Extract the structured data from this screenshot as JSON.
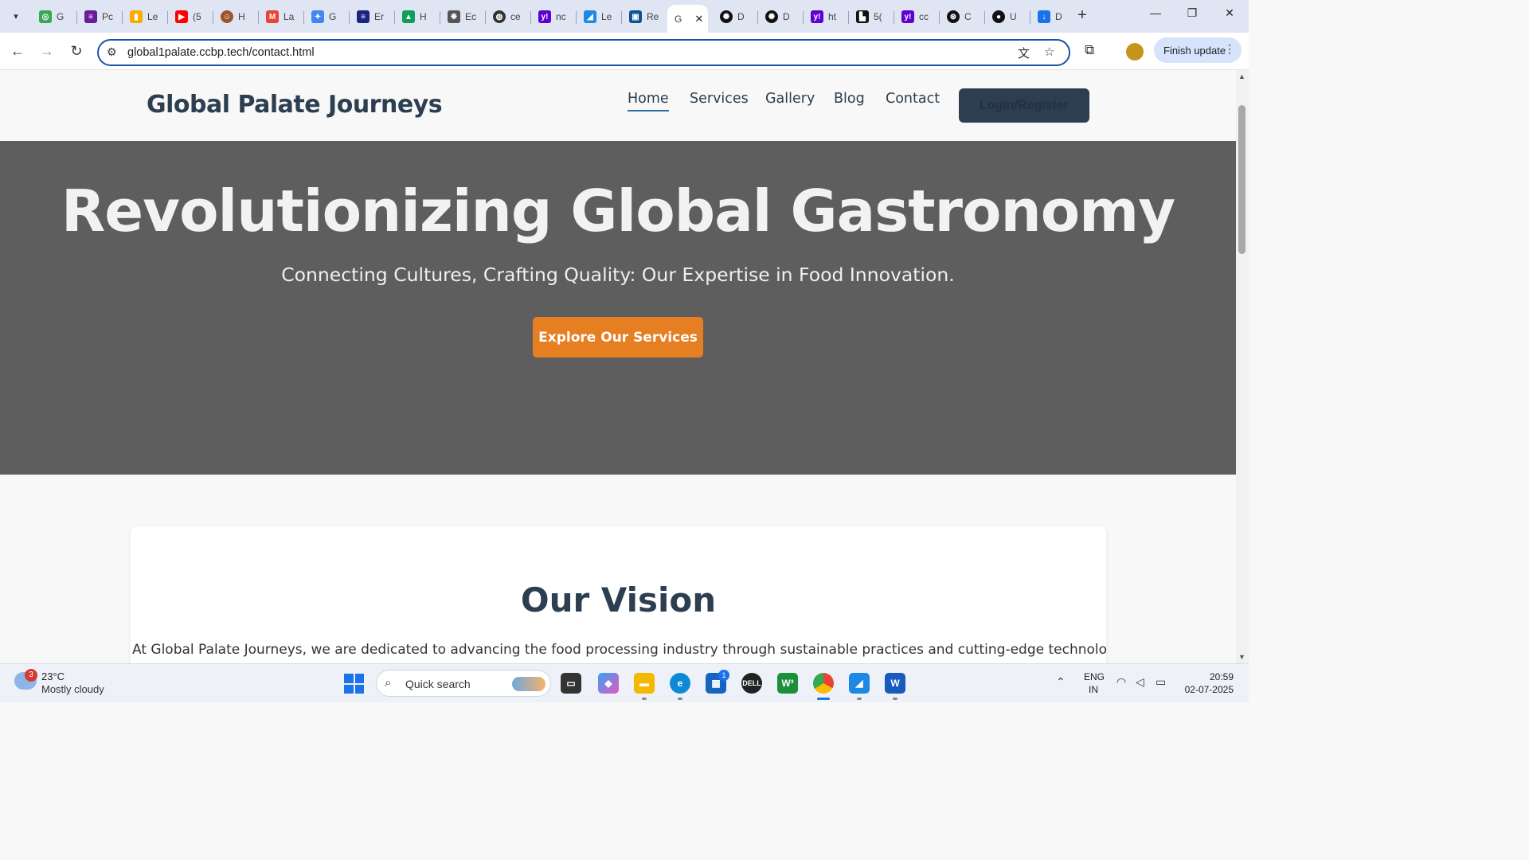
{
  "browser": {
    "tabs": [
      {
        "icon": "search-tabs-icon"
      },
      {
        "title": "G",
        "icon": "google-lens-icon",
        "color": "#34a853"
      },
      {
        "title": "Pc",
        "icon": "notes-icon",
        "color": "#6a1b9a"
      },
      {
        "title": "Le",
        "icon": "chart-icon",
        "color": "#f9ab00"
      },
      {
        "title": "(5",
        "icon": "youtube-icon",
        "color": "#ff0000"
      },
      {
        "title": "H",
        "icon": "avatar-icon",
        "color": "#a0522d"
      },
      {
        "title": "La",
        "icon": "gmail-icon",
        "color": "#ea4335"
      },
      {
        "title": "G",
        "icon": "gemini-icon",
        "color": "#4285f4"
      },
      {
        "title": "Er",
        "icon": "iit-icon",
        "color": "#1a237e"
      },
      {
        "title": "H",
        "icon": "drive-icon",
        "color": "#0f9d58"
      },
      {
        "title": "Ec",
        "icon": "brain-icon",
        "color": "#555555"
      },
      {
        "title": "ce",
        "icon": "globe-icon",
        "color": "#333333"
      },
      {
        "title": "nc",
        "icon": "yahoo-icon",
        "color": "#6001d2"
      },
      {
        "title": "Le",
        "icon": "graph-icon",
        "color": "#1e88e5"
      },
      {
        "title": "Re",
        "icon": "site-icon",
        "color": "#0b5394"
      },
      {
        "title": "G",
        "icon": "page-icon",
        "active": true
      },
      {
        "title": "D",
        "icon": "openai-icon",
        "color": "#111111"
      },
      {
        "title": "D",
        "icon": "openai-icon",
        "color": "#111111"
      },
      {
        "title": "ht",
        "icon": "yahoo-icon",
        "color": "#6001d2"
      },
      {
        "title": "5(",
        "icon": "briefcase-icon",
        "color": "#111111"
      },
      {
        "title": "cc",
        "icon": "yahoo-icon",
        "color": "#6001d2"
      },
      {
        "title": "C",
        "icon": "aperture-icon",
        "color": "#111111"
      },
      {
        "title": "U",
        "icon": "github-icon",
        "color": "#111111"
      },
      {
        "title": "D",
        "icon": "download-icon",
        "color": "#1a73e8"
      }
    ],
    "active_tab_close": "✕",
    "new_tab": "+",
    "window_controls": {
      "minimize": "—",
      "restore": "❐",
      "close": "✕"
    },
    "url": "global1palate.ccbp.tech/contact.html",
    "finish_update": "Finish update"
  },
  "site": {
    "logo": "Global Palate Journeys",
    "nav": [
      {
        "label": "Home",
        "active": true
      },
      {
        "label": "Services"
      },
      {
        "label": "Gallery"
      },
      {
        "label": "Blog"
      },
      {
        "label": "Contact"
      }
    ],
    "login": "Login/Register",
    "hero": {
      "title": "Revolutionizing Global Gastronomy",
      "subtitle": "Connecting Cultures, Crafting Quality: Our Expertise in Food Innovation.",
      "cta": "Explore Our Services"
    },
    "vision": {
      "title": "Our Vision",
      "text": "At Global Palate Journeys, we are dedicated to advancing the food processing industry through sustainable practices and cutting-edge technology. Our mission is"
    },
    "colors": {
      "primary": "#2c3e50",
      "accent": "#e67e22",
      "hero_bg": "#5e5e5e"
    }
  },
  "taskbar": {
    "weather": {
      "badge": "3",
      "temp": "23°C",
      "condition": "Mostly cloudy"
    },
    "search_label": "Quick search",
    "apps": [
      {
        "name": "task-view",
        "icon": "task-view-icon"
      },
      {
        "name": "copilot",
        "icon": "copilot-icon"
      },
      {
        "name": "file-explorer",
        "icon": "folder-icon"
      },
      {
        "name": "edge",
        "icon": "edge-icon"
      },
      {
        "name": "store",
        "icon": "store-icon",
        "badge": "1"
      },
      {
        "name": "dell",
        "icon": "dell-icon"
      },
      {
        "name": "w3",
        "icon": "w3-icon"
      },
      {
        "name": "chrome",
        "icon": "chrome-icon",
        "active": true
      },
      {
        "name": "photos",
        "icon": "photos-icon"
      },
      {
        "name": "word",
        "icon": "word-icon"
      }
    ],
    "lang": [
      "ENG",
      "IN"
    ],
    "time": "20:59",
    "date": "02-07-2025"
  }
}
